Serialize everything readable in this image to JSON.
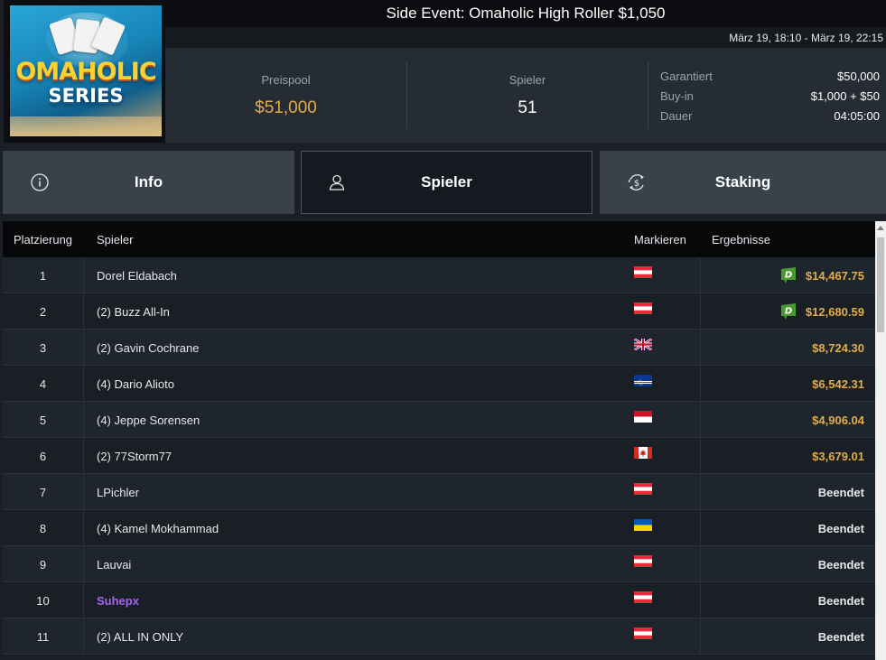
{
  "logo": {
    "line1": "OMAHOLIC",
    "line2": "SERIES"
  },
  "header": {
    "title": "Side Event: Omaholic High Roller $1,050",
    "dates": "März 19, 18:10 - März 19, 22:15"
  },
  "stats": {
    "prize_pool_label": "Preispool",
    "prize_pool_value": "$51,000",
    "players_label": "Spieler",
    "players_value": "51",
    "details": [
      {
        "label": "Garantiert",
        "value": "$50,000"
      },
      {
        "label": "Buy-in",
        "value": "$1,000 + $50"
      },
      {
        "label": "Dauer",
        "value": "04:05:00"
      }
    ]
  },
  "tabs": [
    {
      "label": "Info",
      "icon": "info-icon",
      "active": false
    },
    {
      "label": "Spieler",
      "icon": "user-icon",
      "active": true
    },
    {
      "label": "Staking",
      "icon": "dollar-cycle-icon",
      "active": false
    }
  ],
  "table": {
    "headers": {
      "place": "Platzierung",
      "player": "Spieler",
      "flag": "Markieren",
      "result": "Ergebnisse"
    },
    "rows": [
      {
        "place": "1",
        "name": "Dorel Eldabach",
        "flag": "austria",
        "result": "$14,467.75",
        "paid": true,
        "badge": "D"
      },
      {
        "place": "2",
        "name": "(2) Buzz All-In",
        "flag": "austria",
        "result": "$12,680.59",
        "paid": true,
        "badge": "D"
      },
      {
        "place": "3",
        "name": "(2) Gavin Cochrane",
        "flag": "united-kingdom",
        "result": "$8,724.30",
        "paid": true
      },
      {
        "place": "4",
        "name": "(4) Dario Alioto",
        "flag": "cape-verde",
        "result": "$6,542.31",
        "paid": true
      },
      {
        "place": "5",
        "name": "(4) Jeppe Sorensen",
        "flag": "monaco",
        "result": "$4,906.04",
        "paid": true
      },
      {
        "place": "6",
        "name": "(2) 77Storm77",
        "flag": "canada",
        "result": "$3,679.01",
        "paid": true
      },
      {
        "place": "7",
        "name": "LPichler",
        "flag": "austria",
        "result": "Beendet",
        "paid": false
      },
      {
        "place": "8",
        "name": "(4) Kamel Mokhammad",
        "flag": "ukraine",
        "result": "Beendet",
        "paid": false
      },
      {
        "place": "9",
        "name": "Lauvai",
        "flag": "austria",
        "result": "Beendet",
        "paid": false
      },
      {
        "place": "10",
        "name": "Suhepx",
        "flag": "austria",
        "result": "Beendet",
        "paid": false,
        "highlight": true
      },
      {
        "place": "11",
        "name": "(2) ALL IN ONLY",
        "flag": "austria",
        "result": "Beendet",
        "paid": false
      }
    ]
  },
  "colors": {
    "accent_gold": "#e2ac49",
    "highlight_purple": "#a463f2",
    "badge_green": "#4a9a2e"
  }
}
